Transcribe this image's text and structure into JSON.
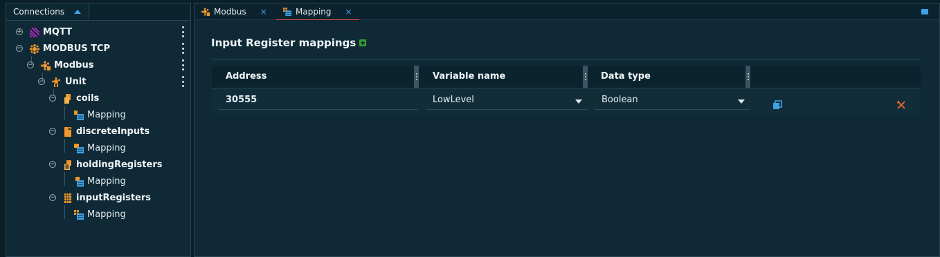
{
  "sidebar": {
    "tab_label": "Connections",
    "tree": [
      {
        "label": "MQTT",
        "toggle": "+"
      },
      {
        "label": "MODBUS TCP",
        "toggle": "−"
      },
      {
        "label": "Modbus",
        "toggle": "−"
      },
      {
        "label": "Unit",
        "toggle": "−"
      },
      {
        "label": "coils",
        "toggle": "−"
      },
      {
        "label": "Mapping"
      },
      {
        "label": "discreteInputs",
        "toggle": "−"
      },
      {
        "label": "Mapping"
      },
      {
        "label": "holdingRegisters",
        "toggle": "−"
      },
      {
        "label": "Mapping"
      },
      {
        "label": "inputRegisters",
        "toggle": "−"
      },
      {
        "label": "Mapping"
      }
    ]
  },
  "tabs": [
    {
      "label": "Modbus",
      "close": "×"
    },
    {
      "label": "Mapping",
      "close": "×"
    }
  ],
  "main": {
    "title": "Input Register mappings",
    "table": {
      "headers": [
        "Address",
        "Variable name",
        "Data type"
      ],
      "rows": [
        {
          "address": "30555",
          "variable": "LowLevel",
          "type": "Boolean"
        }
      ]
    }
  },
  "colors": {
    "accent": "#3ea3e6",
    "modbus_orange": "#f0962a",
    "mqtt_purple": "#a03cc8",
    "add_green": "#33a02c",
    "delete_orange": "#e0642a"
  }
}
